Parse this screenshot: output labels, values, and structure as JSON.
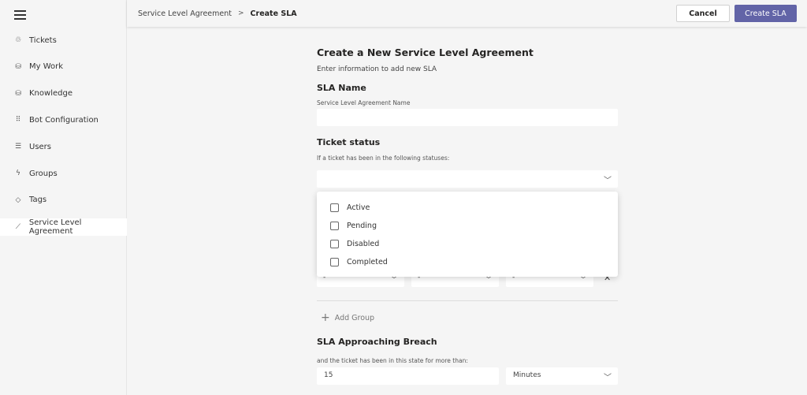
{
  "sidebar": {
    "items": [
      {
        "label": "Tickets",
        "icon": "tickets-icon",
        "glyph": "♲"
      },
      {
        "label": "My Work",
        "icon": "my-work-icon",
        "glyph": "⛁"
      },
      {
        "label": "Knowledge",
        "icon": "knowledge-icon",
        "glyph": "⛁"
      },
      {
        "label": "Bot Configuration",
        "icon": "bot-config-icon",
        "glyph": "⠿"
      },
      {
        "label": "Users",
        "icon": "users-icon",
        "glyph": "☰"
      },
      {
        "label": "Groups",
        "icon": "groups-icon",
        "glyph": "ϟ"
      },
      {
        "label": "Tags",
        "icon": "tag-icon",
        "glyph": "◇"
      },
      {
        "label": "Service Level Agreement",
        "icon": "sla-icon",
        "glyph": "⟋"
      }
    ],
    "active": "Service Level Agreement"
  },
  "header": {
    "breadcrumb": [
      "Service Level Agreement",
      "Create SLA"
    ],
    "separator": ">",
    "cancel": "Cancel",
    "create": "Create SLA"
  },
  "form": {
    "title": "Create a New Service Level Agreement",
    "subtitle": "Enter information to add new SLA",
    "sla_name": {
      "label": "SLA Name",
      "sublabel": "Service Level Agreement Name",
      "value": ""
    },
    "ticket_status": {
      "label": "Ticket status",
      "sublabel": "If a ticket has been in the following statuses:",
      "options": [
        "Active",
        "Pending",
        "Disabled",
        "Completed"
      ]
    },
    "group_row": [
      "-",
      "-",
      "-"
    ],
    "add_group": "Add Group",
    "breach": {
      "label": "SLA Approaching Breach",
      "sublabel": "and the ticket has been in this state for more than:",
      "value": "15",
      "unit": "Minutes"
    }
  },
  "colors": {
    "accent": "#6264a7"
  }
}
